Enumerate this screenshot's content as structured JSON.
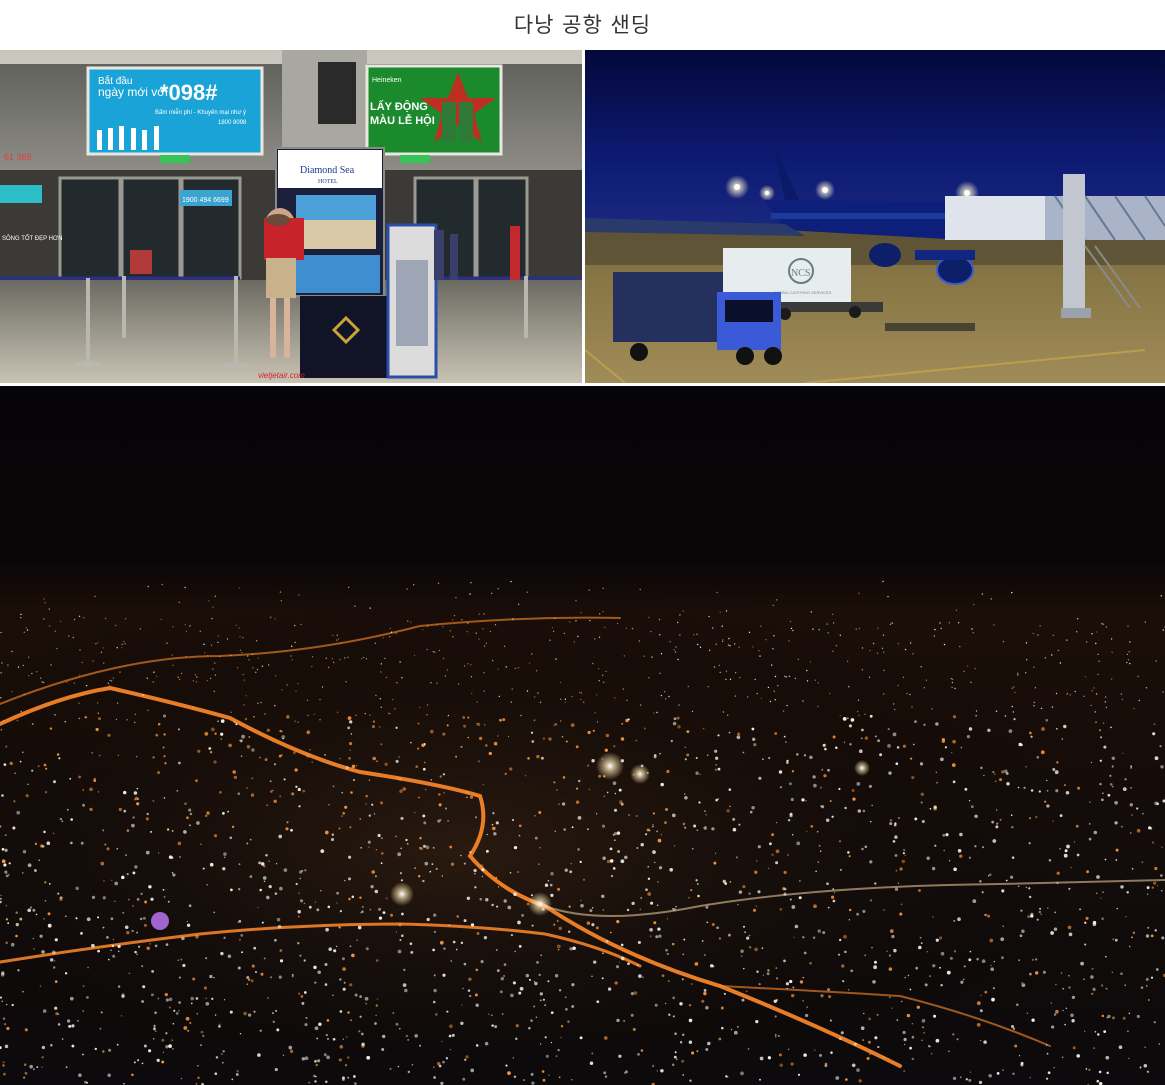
{
  "page": {
    "title": "다낭 공항 샌딩"
  },
  "photos": [
    {
      "id": "terminal",
      "signs": {
        "viettel_left": "Bắt đầu",
        "viettel_left2": "ngày mới với",
        "viettel_number": "*098#",
        "viettel_sub": "Bấm miễn phí - Khuyến mại như ý",
        "viettel_hotline": "1800 8098",
        "heineken_text": "LẤY ĐỘNG",
        "heineken_text2": "MÀU LỄ HỘI",
        "heineken_brand": "Heineken",
        "hotel_name": "Diamond Sea",
        "hotel_sub": "HOTEL",
        "shop_sign": "SÔNG TỐT ĐẸP HƠN",
        "phone_left": "61 368",
        "phone_center": "1900 494 6699",
        "vietjet": "vietjetair.com"
      }
    },
    {
      "id": "apron",
      "signs": {
        "truck_logo": "NCS",
        "truck_sub": "NOIBAI CATERING SERVICES"
      }
    },
    {
      "id": "aerial"
    }
  ],
  "colors": {
    "night_sky": "#04040a",
    "city_orange": "#ff9a3c",
    "city_white": "#f4f1e6",
    "apron_blue": "#0a1460",
    "sodium_light": "#c7a24a"
  }
}
